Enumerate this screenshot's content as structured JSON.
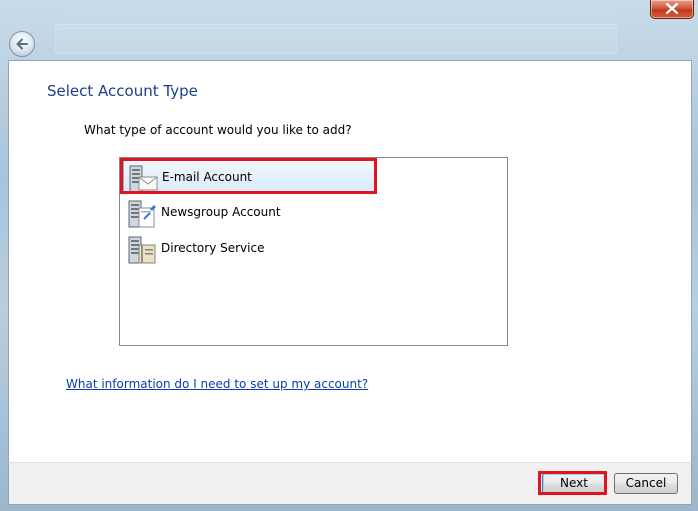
{
  "window": {
    "close_icon": "close-icon",
    "back_icon": "back-arrow-icon"
  },
  "page": {
    "title": "Select Account Type",
    "question": "What type of account would you like to add?"
  },
  "account_types": [
    {
      "label": "E-mail Account",
      "icon": "email-server-icon",
      "selected": true
    },
    {
      "label": "Newsgroup Account",
      "icon": "newsgroup-server-icon",
      "selected": false
    },
    {
      "label": "Directory Service",
      "icon": "directory-server-icon",
      "selected": false
    }
  ],
  "help_link": "What information do I need to set up my account?",
  "buttons": {
    "next": "Next",
    "cancel": "Cancel"
  },
  "colors": {
    "title": "#1d3f8a",
    "link": "#0a3fb0",
    "highlight": "#e0141e",
    "selection": "#d8eaf9"
  }
}
